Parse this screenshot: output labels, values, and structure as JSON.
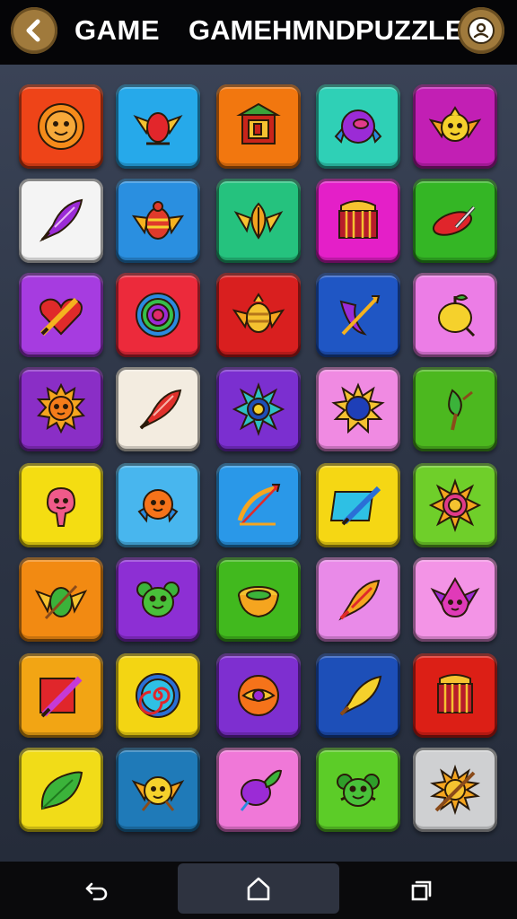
{
  "header": {
    "title_left": "GAME",
    "title_right": "GAMEHMNDPUZZLE",
    "back_icon": "back-chevron-icon",
    "profile_icon": "profile-icon"
  },
  "board": {
    "rows": 8,
    "cols": 5,
    "tiles": [
      {
        "color": "#ee4418",
        "icon": "sun-face"
      },
      {
        "color": "#26a9ea",
        "icon": "winged-gem"
      },
      {
        "color": "#f2770f",
        "icon": "temple-shrine"
      },
      {
        "color": "#2fd0b6",
        "icon": "purple-eye-orb"
      },
      {
        "color": "#c21fb4",
        "icon": "winged-face"
      },
      {
        "color": "#f4f4f4",
        "icon": "purple-feather"
      },
      {
        "color": "#2a8fe0",
        "icon": "winged-beetle"
      },
      {
        "color": "#25c27e",
        "icon": "winged-leaf"
      },
      {
        "color": "#e41fc8",
        "icon": "treasure-drum"
      },
      {
        "color": "#34b625",
        "icon": "red-pill-wand"
      },
      {
        "color": "#a63ce0",
        "icon": "heart-quill"
      },
      {
        "color": "#ec2a3b",
        "icon": "spiral-target"
      },
      {
        "color": "#d91f1f",
        "icon": "golden-beetle"
      },
      {
        "color": "#1f56c4",
        "icon": "purple-bow"
      },
      {
        "color": "#ec7de6",
        "icon": "lemon-fruit"
      },
      {
        "color": "#8a2ec6",
        "icon": "lion-sun"
      },
      {
        "color": "#f3ece0",
        "icon": "red-feather"
      },
      {
        "color": "#7b2fd0",
        "icon": "blue-star"
      },
      {
        "color": "#f08ae2",
        "icon": "blue-sun"
      },
      {
        "color": "#4cb81f",
        "icon": "green-leaf-wand"
      },
      {
        "color": "#f4dd12",
        "icon": "pink-blob"
      },
      {
        "color": "#48b6ee",
        "icon": "orange-face"
      },
      {
        "color": "#2a98e8",
        "icon": "golden-bow"
      },
      {
        "color": "#f5d714",
        "icon": "blue-quill"
      },
      {
        "color": "#6fcf2a",
        "icon": "sun-star"
      },
      {
        "color": "#f28a12",
        "icon": "green-winged-gem"
      },
      {
        "color": "#8d2fd4",
        "icon": "green-monster"
      },
      {
        "color": "#41b91e",
        "icon": "golden-bowl"
      },
      {
        "color": "#e98ae8",
        "icon": "orange-feather"
      },
      {
        "color": "#f394e6",
        "icon": "pink-creature"
      },
      {
        "color": "#f2a514",
        "icon": "red-box-quill"
      },
      {
        "color": "#f3d513",
        "icon": "blue-spiral"
      },
      {
        "color": "#7e2fd0",
        "icon": "orange-eye"
      },
      {
        "color": "#1d4fb8",
        "icon": "yellow-feather"
      },
      {
        "color": "#dc1f16",
        "icon": "red-drum"
      },
      {
        "color": "#f1dc18",
        "icon": "green-leaf"
      },
      {
        "color": "#1f7ab8",
        "icon": "yellow-winged-face"
      },
      {
        "color": "#f078d8",
        "icon": "purple-plum"
      },
      {
        "color": "#5ccc28",
        "icon": "green-face"
      },
      {
        "color": "#cfd0d2",
        "icon": "golden-sun-wand"
      }
    ]
  },
  "nav": {
    "back_icon": "back-arrow-icon",
    "home_icon": "home-icon",
    "recents_icon": "recents-icon"
  }
}
